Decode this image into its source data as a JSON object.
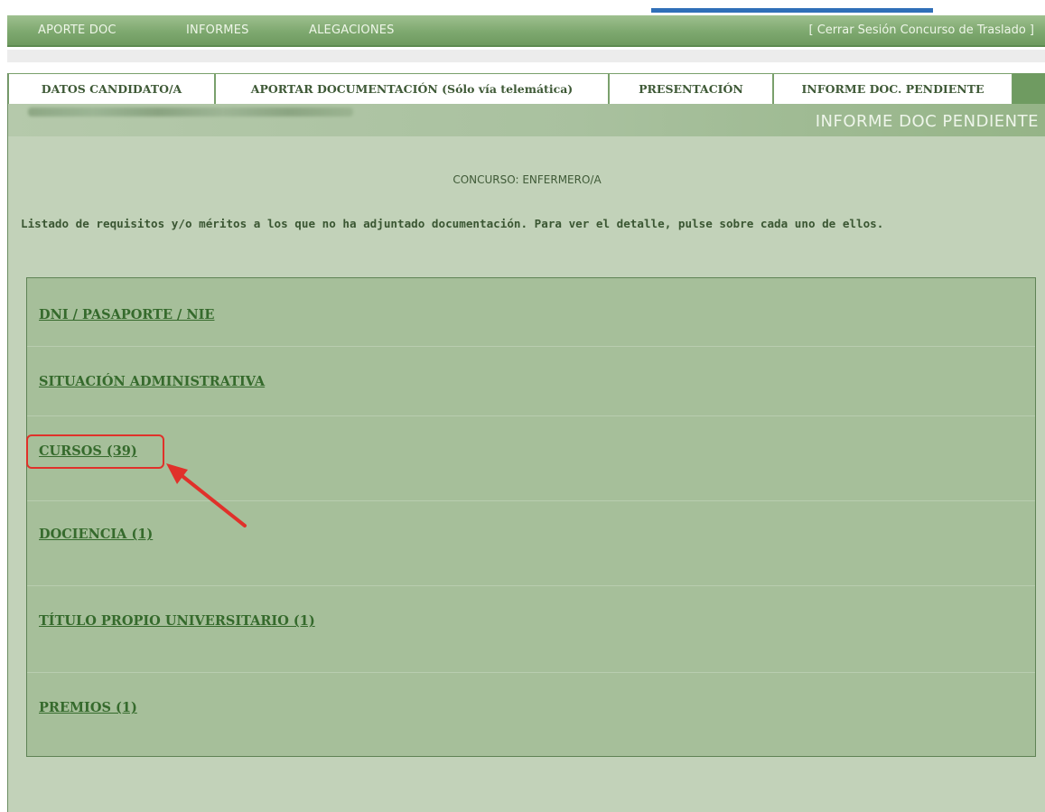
{
  "nav": {
    "items": [
      {
        "label": "APORTE DOC"
      },
      {
        "label": "INFORMES"
      },
      {
        "label": "ALEGACIONES"
      }
    ],
    "logout_label": "[ Cerrar Sesión Concurso de Traslado ]"
  },
  "tabs": [
    {
      "label": "DATOS CANDIDATO/A"
    },
    {
      "label": "APORTAR DOCUMENTACIÓN (Sólo vía telemática)"
    },
    {
      "label": "PRESENTACIÓN"
    },
    {
      "label": "INFORME DOC. PENDIENTE"
    }
  ],
  "header": {
    "section_title": "INFORME DOC PENDIENTE"
  },
  "main": {
    "concurso": "CONCURSO: ENFERMERO/A",
    "intro": "Listado de requisitos y/o méritos a los que no ha adjuntado documentación. Para ver el detalle, pulse sobre cada uno de ellos.",
    "items": [
      {
        "label": "DNI / PASAPORTE / NIE"
      },
      {
        "label": "SITUACIÓN ADMINISTRATIVA"
      },
      {
        "label": "CURSOS (39)"
      },
      {
        "label": "DOCIENCIA (1)"
      },
      {
        "label": "TÍTULO PROPIO UNIVERSITARIO (1)"
      },
      {
        "label": "PREMIOS (1)"
      }
    ]
  },
  "annotation": {
    "color": "#e0312a"
  }
}
